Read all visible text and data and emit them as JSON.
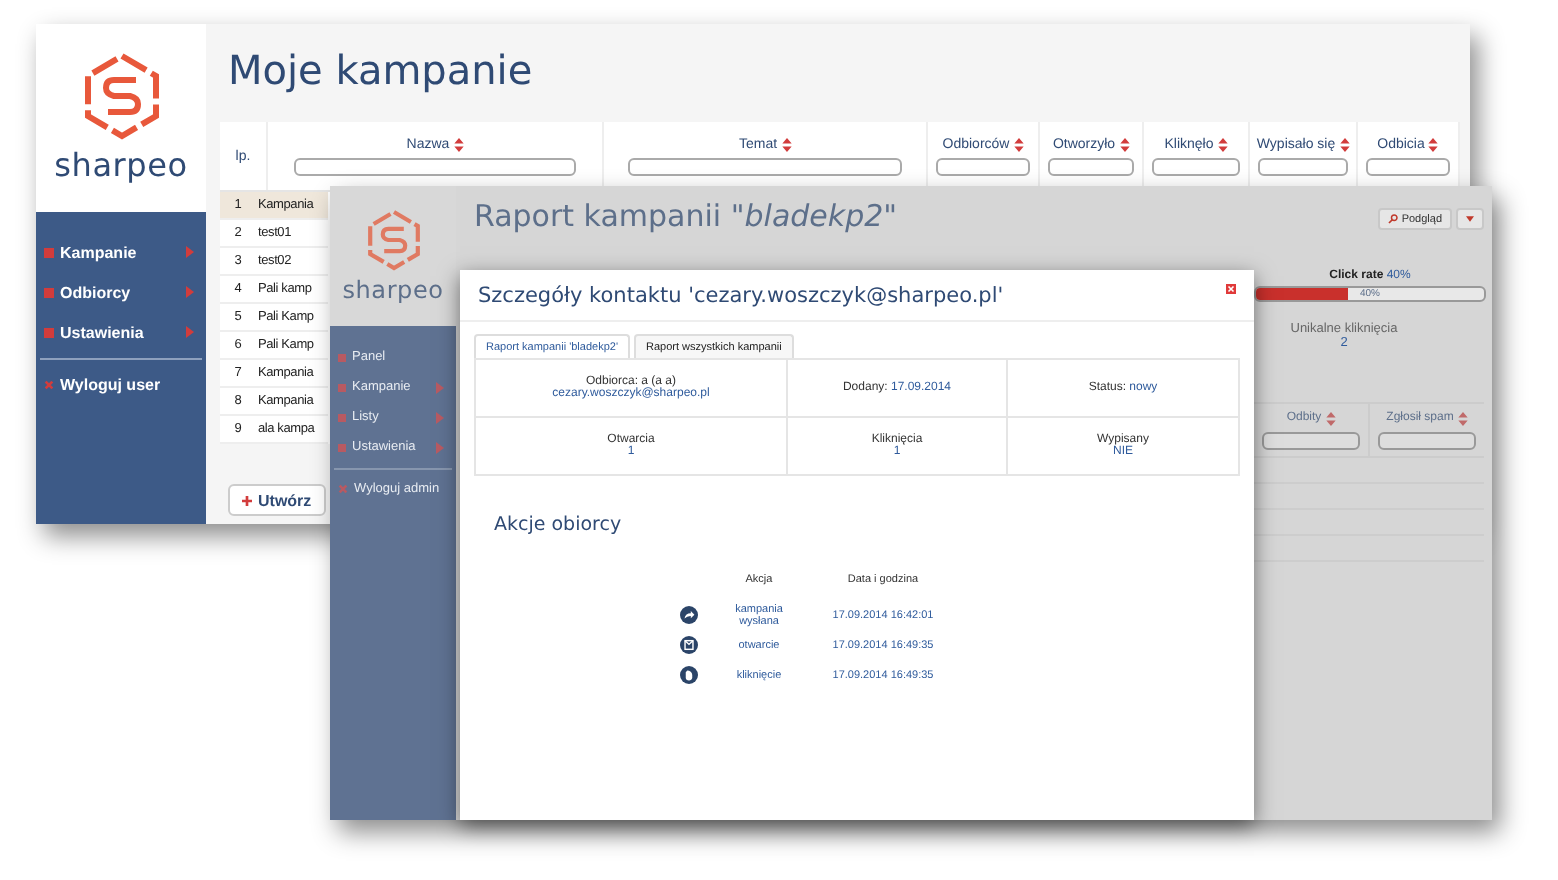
{
  "back_window": {
    "logo": "sharpeo",
    "title": "Moje kampanie",
    "nav": [
      {
        "label": "Kampanie",
        "submenu": true
      },
      {
        "label": "Odbiorcy",
        "submenu": true
      },
      {
        "label": "Ustawienia",
        "submenu": true
      }
    ],
    "logout": "Wyloguj user",
    "table": {
      "columns": [
        {
          "label": "lp.",
          "sortable": false
        },
        {
          "label": "Nazwa",
          "sortable": true
        },
        {
          "label": "Temat",
          "sortable": true
        },
        {
          "label": "Odbiorców",
          "sortable": true
        },
        {
          "label": "Otworzyło",
          "sortable": true
        },
        {
          "label": "Kliknęło",
          "sortable": true
        },
        {
          "label": "Wypisało się",
          "sortable": true
        },
        {
          "label": "Odbicia",
          "sortable": true
        }
      ],
      "rows": [
        {
          "lp": "1",
          "name": "Kampania",
          "selected": true
        },
        {
          "lp": "2",
          "name": "test01",
          "selected": false
        },
        {
          "lp": "3",
          "name": "test02",
          "selected": false
        },
        {
          "lp": "4",
          "name": "Pali kamp",
          "selected": false
        },
        {
          "lp": "5",
          "name": "Pali Kamp",
          "selected": false
        },
        {
          "lp": "6",
          "name": "Pali Kamp",
          "selected": false
        },
        {
          "lp": "7",
          "name": "Kampania",
          "selected": false
        },
        {
          "lp": "8",
          "name": "Kampania",
          "selected": false
        },
        {
          "lp": "9",
          "name": "ala kampa",
          "selected": false
        }
      ]
    },
    "create_button": "Utwórz"
  },
  "report_window": {
    "logo": "sharpeo",
    "title": "Raport kampanii *\"bladekp2\"*",
    "nav": [
      {
        "label": "Panel",
        "submenu": false
      },
      {
        "label": "Kampanie",
        "submenu": true
      },
      {
        "label": "Listy",
        "submenu": true
      },
      {
        "label": "Ustawienia",
        "submenu": true
      }
    ],
    "logout": "Wyloguj admin",
    "preview_button": "Podgląd",
    "click_rate": {
      "label": "Click rate",
      "value": "40%",
      "level": 0.4,
      "bar_label": "40%"
    },
    "unique_clicks": {
      "label": "Unikalne kliknięcia",
      "value": "2"
    },
    "table": {
      "columns": [
        {
          "label": "Odbity",
          "sortable": true
        },
        {
          "label": "Zgłosił spam",
          "sortable": true
        }
      ]
    }
  },
  "modal": {
    "title": "Szczegóły kontaktu 'cezary.woszczyk@sharpeo.pl'",
    "tabs": [
      {
        "label": "Raport kampanii 'bladekp2'",
        "selected": true
      },
      {
        "label": "Raport wszystkich kampanii",
        "selected": false
      }
    ],
    "info_rows": [
      [
        {
          "kind": "stacked",
          "label": "Odbiorca: a (a a)",
          "value": "cezary.woszczyk@sharpeo.pl"
        },
        {
          "kind": "inline",
          "label": "Dodany:",
          "value": "17.09.2014"
        },
        {
          "kind": "inline",
          "label": "Status:",
          "value": "nowy"
        }
      ],
      [
        {
          "kind": "stacked",
          "label": "Otwarcia",
          "value": "1"
        },
        {
          "kind": "stacked",
          "label": "Kliknięcia",
          "value": "1"
        },
        {
          "kind": "stacked",
          "label": "Wypisany",
          "value": "NIE"
        }
      ]
    ],
    "actions_title": "Akcje obiorcy",
    "actions_columns": [
      "Akcja",
      "Data i godzina"
    ],
    "actions": [
      {
        "kind": "sent",
        "action": "kampania wysłana",
        "time": "17.09.2014 16:42:01"
      },
      {
        "kind": "open",
        "action": "otwarcie",
        "time": "17.09.2014 16:49:35"
      },
      {
        "kind": "click",
        "action": "kliknięcie",
        "time": "17.09.2014 16:49:35"
      }
    ]
  }
}
